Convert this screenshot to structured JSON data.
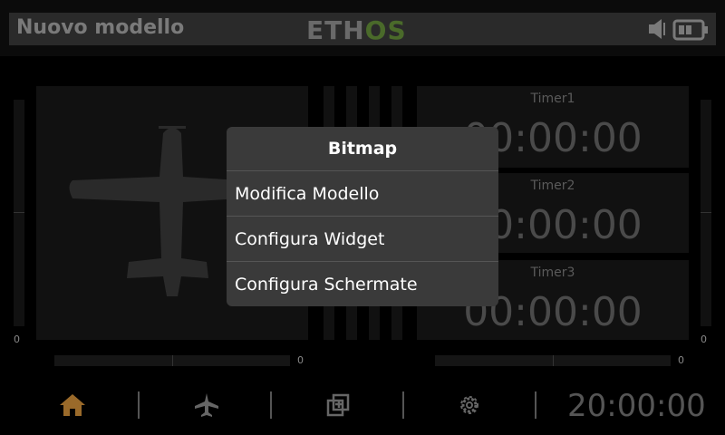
{
  "header": {
    "title": "Nuovo modello",
    "logo_part1": "ETH",
    "logo_part2": "OS",
    "icons": [
      "speaker-icon",
      "battery-icon"
    ]
  },
  "left_slider": {
    "value_label": "0"
  },
  "right_slider": {
    "value_label": "0"
  },
  "left_trim": {
    "value_label": "0"
  },
  "right_trim": {
    "value_label": "0"
  },
  "timers": [
    {
      "label": "Timer1",
      "value": "00:00:00"
    },
    {
      "label": "Timer2",
      "value": "00:00:00"
    },
    {
      "label": "Timer3",
      "value": "00:00:00"
    }
  ],
  "popup": {
    "title": "Bitmap",
    "items": [
      "Modifica Modello",
      "Configura Widget",
      "Configura Schermate"
    ]
  },
  "nav": {
    "icons": [
      "home-icon",
      "airplane-icon",
      "screens-icon",
      "gear-icon"
    ],
    "clock": "20:00:00"
  },
  "colors": {
    "accent": "#9a6a2a",
    "logo_os": "#4a6a2a"
  }
}
